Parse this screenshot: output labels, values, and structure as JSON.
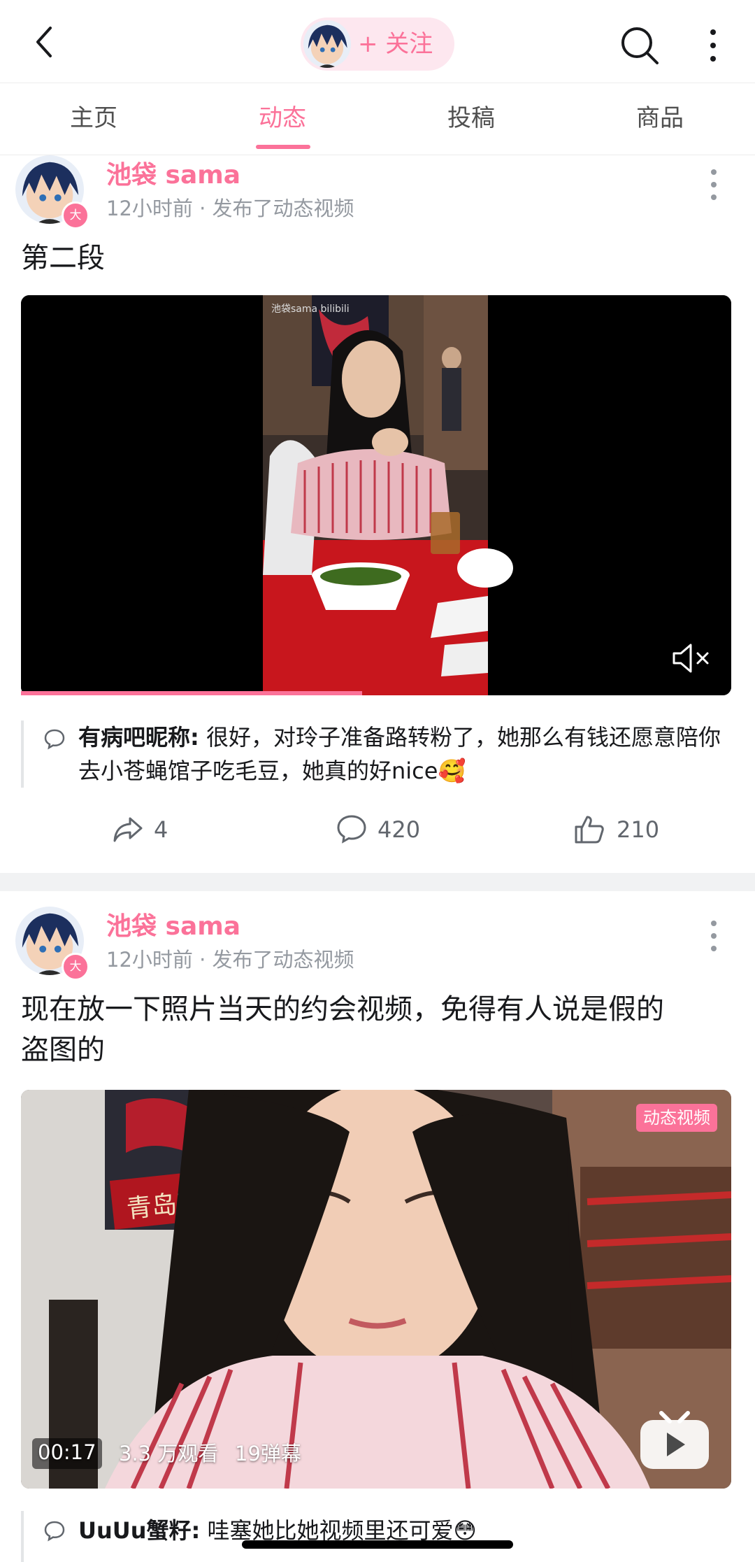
{
  "header": {
    "follow_label": "+ 关注"
  },
  "tabs": [
    {
      "label": "主页"
    },
    {
      "label": "动态"
    },
    {
      "label": "投稿"
    },
    {
      "label": "商品"
    }
  ],
  "colors": {
    "accent": "#fb7299",
    "muted": "#9499a0",
    "text": "#18191c"
  },
  "posts": [
    {
      "author": "池袋 sama",
      "badge": "大",
      "meta": "12小时前 · 发布了动态视频",
      "text": "第二段",
      "video": {
        "watermark": "池袋sama bilibili",
        "muted": true,
        "progress": 0.48
      },
      "comment": {
        "user": "有病吧昵称:",
        "text": "很好，对玲子准备路转粉了，她那么有钱还愿意陪你去小苍蝇馆子吃毛豆，她真的好nice🥰"
      },
      "actions": {
        "share": "4",
        "comments": "420",
        "likes": "210"
      }
    },
    {
      "author": "池袋 sama",
      "badge": "大",
      "meta": "12小时前 · 发布了动态视频",
      "text_line1": "现在放一下照片当天的约会视频，免得有人说是假的",
      "text_line2": "盗图的",
      "video": {
        "tag": "动态视频",
        "duration": "00:17",
        "views": "3.3 万观看",
        "danmaku": "19弹幕",
        "sign_text": "青岛啤酒"
      },
      "comment": {
        "user": "UuUu蟹籽:",
        "text": "哇塞她比她视频里还可爱😳"
      }
    }
  ]
}
